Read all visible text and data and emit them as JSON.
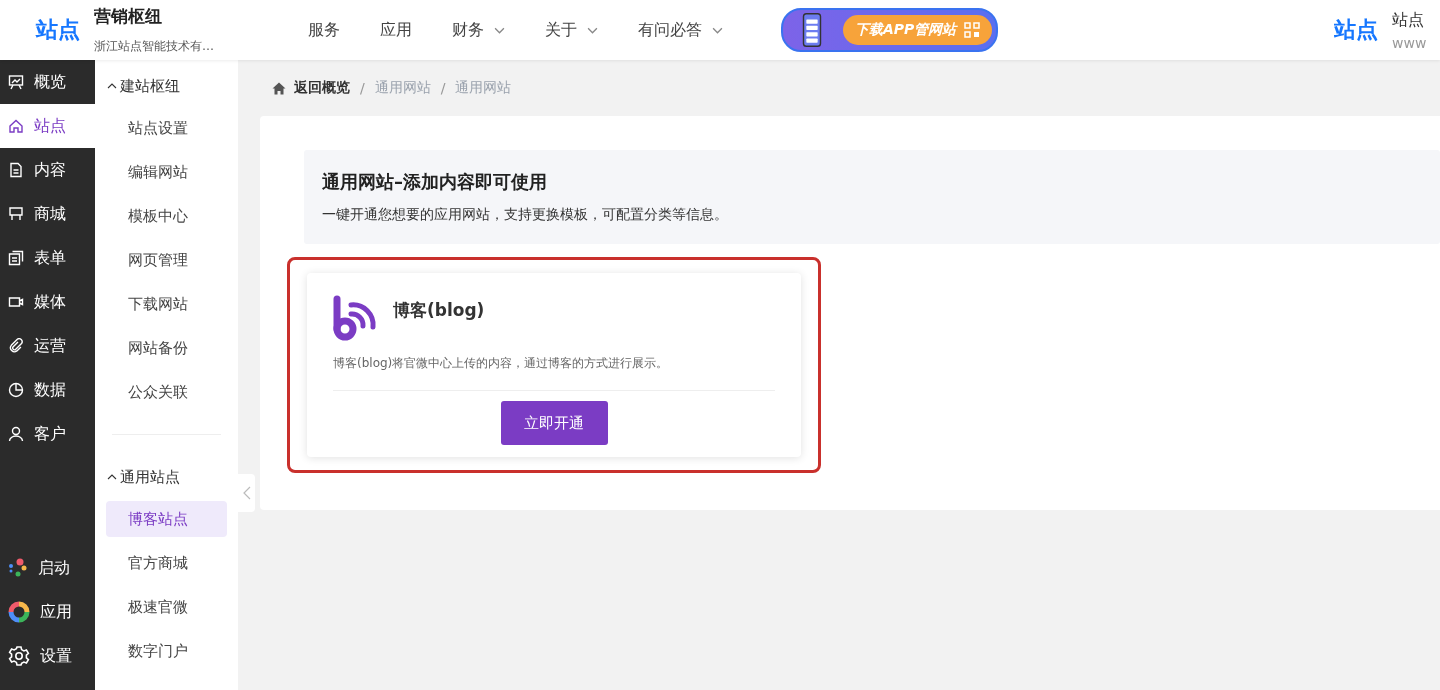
{
  "header": {
    "logo": "站点",
    "title": "营销枢纽",
    "subtitle": "浙江站点智能技术有…",
    "nav": [
      {
        "label": "服务",
        "kind": "link"
      },
      {
        "label": "应用",
        "kind": "link"
      },
      {
        "label": "财务",
        "kind": "dropdown"
      },
      {
        "label": "关于",
        "kind": "dropdown"
      },
      {
        "label": "有问必答",
        "kind": "dropdown"
      }
    ],
    "banner": {
      "label": "下载APP管网站"
    },
    "right_logo": "站点",
    "right_title": "站点",
    "right_url": "www"
  },
  "sidebar": {
    "items": [
      {
        "label": "概览",
        "selected": false
      },
      {
        "label": "站点",
        "selected": true
      },
      {
        "label": "内容",
        "selected": false
      },
      {
        "label": "商城",
        "selected": false
      },
      {
        "label": "表单",
        "selected": false
      },
      {
        "label": "媒体",
        "selected": false
      },
      {
        "label": "运营",
        "selected": false
      },
      {
        "label": "数据",
        "selected": false
      },
      {
        "label": "客户",
        "selected": false
      }
    ],
    "bottom": [
      {
        "label": "启动"
      },
      {
        "label": "应用"
      },
      {
        "label": "设置"
      }
    ]
  },
  "submenu": {
    "groups": [
      {
        "title": "建站枢纽",
        "expanded": true,
        "items": [
          {
            "label": "站点设置",
            "selected": false
          },
          {
            "label": "编辑网站",
            "selected": false
          },
          {
            "label": "模板中心",
            "selected": false
          },
          {
            "label": "网页管理",
            "selected": false
          },
          {
            "label": "下载网站",
            "selected": false
          },
          {
            "label": "网站备份",
            "selected": false
          },
          {
            "label": "公众关联",
            "selected": false
          }
        ]
      },
      {
        "title": "通用站点",
        "expanded": true,
        "items": [
          {
            "label": "博客站点",
            "selected": true
          },
          {
            "label": "官方商城",
            "selected": false
          },
          {
            "label": "极速官微",
            "selected": false
          },
          {
            "label": "数字门户",
            "selected": false
          }
        ]
      }
    ]
  },
  "breadcrumb": {
    "separator": "/",
    "items": [
      "返回概览",
      "通用网站",
      "通用网站"
    ]
  },
  "intro": {
    "title": "通用网站–添加内容即可使用",
    "description": "一键开通您想要的应用网站，支持更换模板，可配置分类等信息。"
  },
  "apps": [
    {
      "name": "博客(blog)",
      "description": "博客(blog)将官微中心上传的内容，通过博客的方式进行展示。",
      "button": "立即开通",
      "highlighted": true
    }
  ]
}
